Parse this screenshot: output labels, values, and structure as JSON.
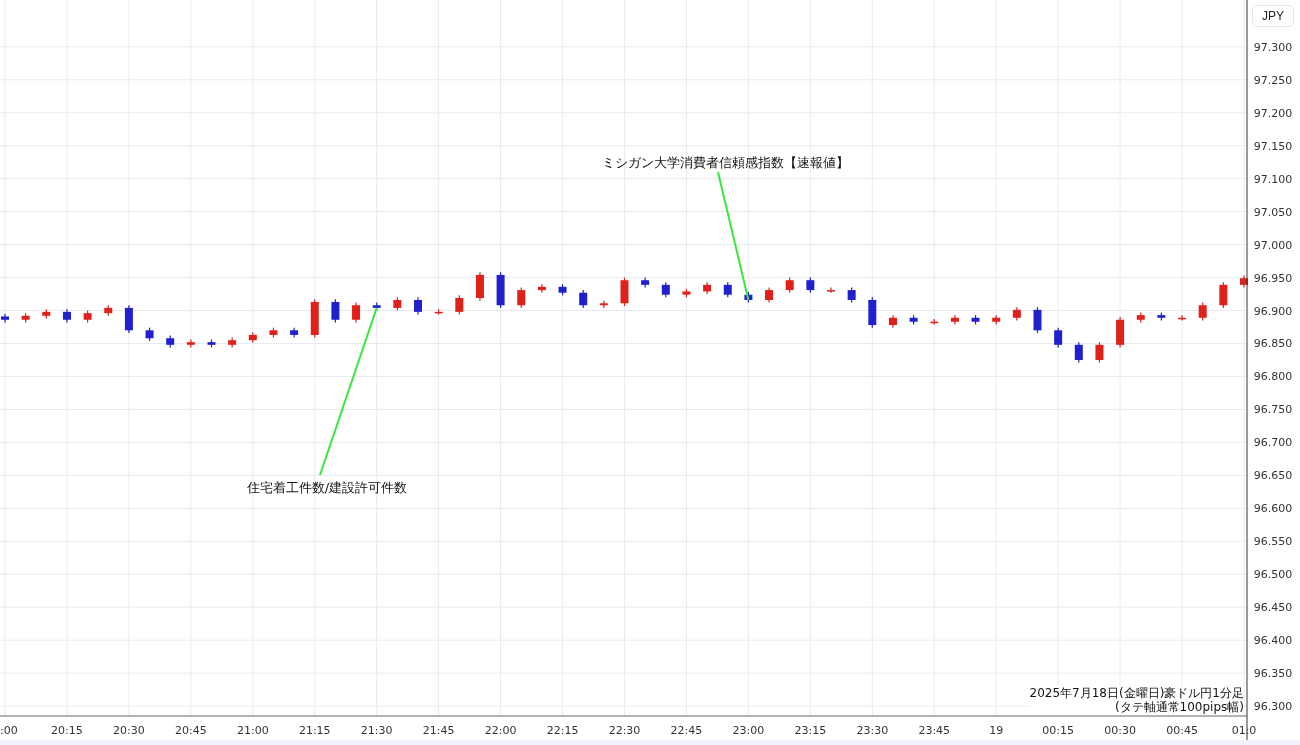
{
  "chart": {
    "currency_button": "JPY",
    "caption": [
      "2025年7月18日(金曜日)豪ドル円1分足",
      "(タテ軸通常100pips幅)"
    ],
    "chart_data": {
      "type": "candlestick",
      "grid": true,
      "ylim": [
        96.285,
        97.371
      ],
      "categories": [
        ":00",
        null,
        null,
        "20:15",
        null,
        null,
        "20:30",
        null,
        null,
        "20:45",
        null,
        null,
        "21:00",
        null,
        null,
        "21:15",
        null,
        null,
        "21:30",
        null,
        null,
        "21:45",
        null,
        null,
        "22:00",
        null,
        null,
        "22:15",
        null,
        null,
        "22:30",
        null,
        null,
        "22:45",
        null,
        null,
        "23:00",
        null,
        null,
        "23:15",
        null,
        null,
        "23:30",
        null,
        null,
        "23:45",
        null,
        null,
        "19",
        null,
        null,
        "00:15",
        null,
        null,
        "00:30",
        null,
        null,
        "00:45",
        null,
        null,
        "01:0"
      ],
      "ohlc": [
        [
          96.891,
          96.895,
          96.882,
          96.886
        ],
        [
          96.886,
          96.896,
          96.882,
          96.892
        ],
        [
          96.892,
          96.902,
          96.888,
          96.898
        ],
        [
          96.898,
          96.902,
          96.882,
          96.886
        ],
        [
          96.886,
          96.9,
          96.882,
          96.896
        ],
        [
          96.896,
          96.908,
          96.892,
          96.904
        ],
        [
          96.904,
          96.908,
          96.866,
          96.87
        ],
        [
          96.87,
          96.874,
          96.854,
          96.858
        ],
        [
          96.858,
          96.862,
          96.844,
          96.848
        ],
        [
          96.848,
          96.856,
          96.844,
          96.852
        ],
        [
          96.852,
          96.856,
          96.844,
          96.848
        ],
        [
          96.848,
          96.859,
          96.844,
          96.855
        ],
        [
          96.855,
          96.867,
          96.851,
          96.863
        ],
        [
          96.863,
          96.874,
          96.859,
          96.87
        ],
        [
          96.87,
          96.874,
          96.859,
          96.863
        ],
        [
          96.863,
          96.917,
          96.859,
          96.913
        ],
        [
          96.913,
          96.917,
          96.882,
          96.886
        ],
        [
          96.886,
          96.912,
          96.882,
          96.908
        ],
        [
          96.908,
          96.912,
          96.9,
          96.904
        ],
        [
          96.904,
          96.92,
          96.9,
          96.916
        ],
        [
          96.916,
          96.92,
          96.894,
          96.898
        ],
        [
          96.898,
          96.902,
          96.894,
          96.898
        ],
        [
          96.898,
          96.923,
          96.894,
          96.919
        ],
        [
          96.919,
          96.958,
          96.915,
          96.954
        ],
        [
          96.954,
          96.958,
          96.904,
          96.908
        ],
        [
          96.908,
          96.935,
          96.904,
          96.931
        ],
        [
          96.931,
          96.94,
          96.927,
          96.936
        ],
        [
          96.936,
          96.94,
          96.923,
          96.927
        ],
        [
          96.927,
          96.931,
          96.904,
          96.908
        ],
        [
          96.908,
          96.915,
          96.904,
          96.911
        ],
        [
          96.911,
          96.95,
          96.907,
          96.946
        ],
        [
          96.946,
          96.95,
          96.935,
          96.939
        ],
        [
          96.939,
          96.943,
          96.92,
          96.924
        ],
        [
          96.924,
          96.933,
          96.92,
          96.929
        ],
        [
          96.929,
          96.943,
          96.925,
          96.939
        ],
        [
          96.939,
          96.943,
          96.92,
          96.924
        ],
        [
          96.924,
          96.928,
          96.912,
          96.916
        ],
        [
          96.916,
          96.935,
          96.912,
          96.931
        ],
        [
          96.931,
          96.95,
          96.927,
          96.946
        ],
        [
          96.946,
          96.95,
          96.927,
          96.931
        ],
        [
          96.931,
          96.935,
          96.927,
          96.931
        ],
        [
          96.931,
          96.935,
          96.912,
          96.916
        ],
        [
          96.916,
          96.92,
          96.874,
          96.878
        ],
        [
          96.878,
          96.893,
          96.874,
          96.889
        ],
        [
          96.889,
          96.893,
          96.879,
          96.883
        ],
        [
          96.883,
          96.887,
          96.879,
          96.883
        ],
        [
          96.883,
          96.893,
          96.879,
          96.889
        ],
        [
          96.889,
          96.893,
          96.879,
          96.883
        ],
        [
          96.883,
          96.893,
          96.879,
          96.889
        ],
        [
          96.889,
          96.905,
          96.885,
          96.901
        ],
        [
          96.901,
          96.905,
          96.866,
          96.87
        ],
        [
          96.87,
          96.874,
          96.844,
          96.848
        ],
        [
          96.848,
          96.852,
          96.821,
          96.825
        ],
        [
          96.825,
          96.852,
          96.821,
          96.848
        ],
        [
          96.848,
          96.89,
          96.844,
          96.886
        ],
        [
          96.886,
          96.897,
          96.882,
          96.893
        ],
        [
          96.893,
          96.897,
          96.885,
          96.889
        ],
        [
          96.889,
          96.893,
          96.885,
          96.889
        ],
        [
          96.889,
          96.912,
          96.885,
          96.908
        ],
        [
          96.908,
          96.943,
          96.904,
          96.939
        ],
        [
          96.939,
          96.953,
          96.935,
          96.949
        ]
      ],
      "yticks": [
        {
          "value": 96.3,
          "label": "96.300"
        },
        {
          "value": 96.35,
          "label": "96.350"
        },
        {
          "value": 96.4,
          "label": "96.400"
        },
        {
          "value": 96.45,
          "label": "96.450"
        },
        {
          "value": 96.5,
          "label": "96.500"
        },
        {
          "value": 96.55,
          "label": "96.550"
        },
        {
          "value": 96.6,
          "label": "96.600"
        },
        {
          "value": 96.65,
          "label": "96.650"
        },
        {
          "value": 96.7,
          "label": "96.700"
        },
        {
          "value": 96.75,
          "label": "96.750"
        },
        {
          "value": 96.8,
          "label": "96.800"
        },
        {
          "value": 96.85,
          "label": "96.850"
        },
        {
          "value": 96.9,
          "label": "96.900"
        },
        {
          "value": 96.95,
          "label": "96.950"
        },
        {
          "value": 97.0,
          "label": "97.000"
        },
        {
          "value": 97.05,
          "label": "97.050"
        },
        {
          "value": 97.1,
          "label": "97.100"
        },
        {
          "value": 97.15,
          "label": "97.150"
        },
        {
          "value": 97.2,
          "label": "97.200"
        },
        {
          "value": 97.25,
          "label": "97.250"
        },
        {
          "value": 97.3,
          "label": "97.300"
        }
      ],
      "annotations": [
        "住宅着工件数/建設許可件数",
        "ミシガン大学消費者信頼感指数【速報値】"
      ]
    }
  }
}
